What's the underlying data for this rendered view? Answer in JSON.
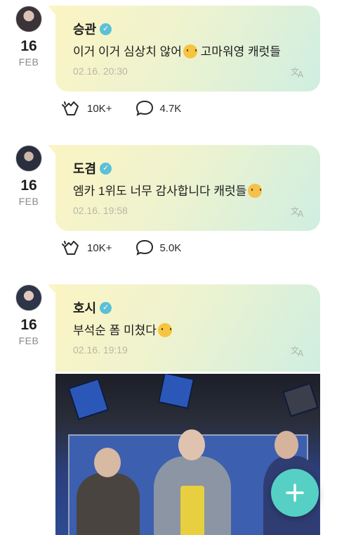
{
  "posts": [
    {
      "author": "승관",
      "day": "16",
      "month": "FEB",
      "text": "이거 이거 심상치 않어",
      "text_after_emoji": " 고마워영 캐럿들",
      "emoji": "shushing-face",
      "time": "02.16. 20:30",
      "likes": "10K+",
      "comments": "4.7K"
    },
    {
      "author": "도겸",
      "day": "16",
      "month": "FEB",
      "text": "엠카 1위도 너무 감사합니다 캐럿들",
      "text_after_emoji": "",
      "emoji": "smiling-face-with-hearts",
      "time": "02.16. 19:58",
      "likes": "10K+",
      "comments": "5.0K"
    },
    {
      "author": "호시",
      "day": "16",
      "month": "FEB",
      "text": "부석순 폼 미쳤다",
      "text_after_emoji": "",
      "emoji": "hugging-face",
      "time": "02.16. 19:19"
    }
  ],
  "fab": {
    "icon": "plus-icon"
  },
  "colors": {
    "accent": "#56d0c4",
    "verified": "#5cc0d7"
  }
}
